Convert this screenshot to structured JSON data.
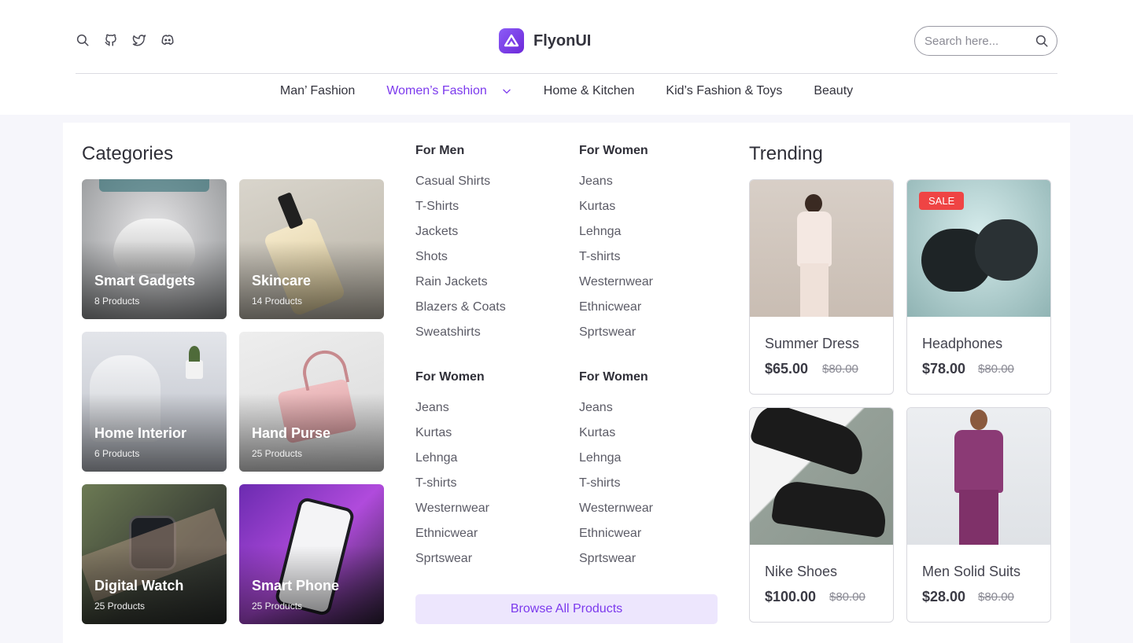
{
  "brand": {
    "name": "FlyonUI"
  },
  "header_icons": [
    "search-icon",
    "github-icon",
    "twitter-icon",
    "discord-icon"
  ],
  "search": {
    "placeholder": "Search here..."
  },
  "nav": [
    {
      "label": "Man’ Fashion",
      "active": false
    },
    {
      "label": "Women’s Fashion",
      "active": true
    },
    {
      "label": "Home & Kitchen",
      "active": false
    },
    {
      "label": "Kid’s Fashion & Toys",
      "active": false
    },
    {
      "label": "Beauty",
      "active": false
    }
  ],
  "categories": {
    "title": "Categories",
    "items": [
      {
        "name": "Smart Gadgets",
        "count": "8 Products"
      },
      {
        "name": "Skincare",
        "count": "14 Products"
      },
      {
        "name": "Home Interior",
        "count": "6 Products"
      },
      {
        "name": "Hand Purse",
        "count": "25 Products"
      },
      {
        "name": "Digital Watch",
        "count": "25 Products"
      },
      {
        "name": "Smart Phone",
        "count": "25 Products"
      }
    ]
  },
  "links": {
    "group1": {
      "title": "For Men",
      "items": [
        "Casual Shirts",
        "T-Shirts",
        "Jackets",
        "Shots",
        "Rain Jackets",
        "Blazers & Coats",
        "Sweatshirts"
      ]
    },
    "group2": {
      "title": "For Women",
      "items": [
        "Jeans",
        "Kurtas",
        "Lehnga",
        "T-shirts",
        "Westernwear",
        "Ethnicwear",
        "Sprtswear"
      ]
    },
    "group3": {
      "title": "For Women",
      "items": [
        "Jeans",
        "Kurtas",
        "Lehnga",
        "T-shirts",
        "Westernwear",
        "Ethnicwear",
        "Sprtswear"
      ]
    },
    "group4": {
      "title": "For Women",
      "items": [
        "Jeans",
        "Kurtas",
        "Lehnga",
        "T-shirts",
        "Westernwear",
        "Ethnicwear",
        "Sprtswear"
      ]
    }
  },
  "browse_label": "Browse All Products",
  "trending": {
    "title": "Trending",
    "sale_label": "SALE",
    "products": [
      {
        "name": "Summer Dress",
        "price": "$65.00",
        "old_price": "$80.00"
      },
      {
        "name": "Headphones",
        "price": "$78.00",
        "old_price": "$80.00"
      },
      {
        "name": "Nike Shoes",
        "price": "$100.00",
        "old_price": "$80.00"
      },
      {
        "name": "Men Solid Suits",
        "price": "$28.00",
        "old_price": "$80.00"
      }
    ]
  },
  "colors": {
    "accent": "#7c3aed",
    "accent_light": "#ede6fd",
    "sale": "#ef4444"
  }
}
